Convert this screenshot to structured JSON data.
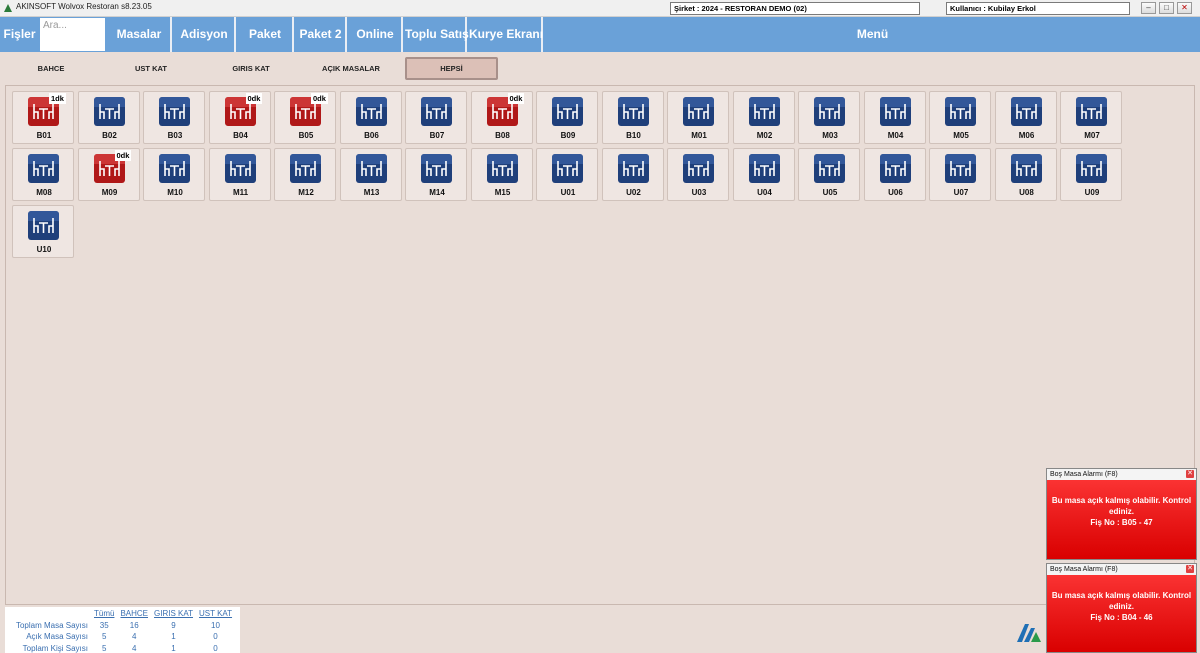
{
  "window": {
    "title": "AKINSOFT Wolvox Restoran s8.23.05",
    "company": "Şirket : 2024 - RESTORAN DEMO (02)",
    "user": "Kullanıcı : Kubilay Erkol"
  },
  "nav": {
    "fisler": "Fişler",
    "search_placeholder": "Ara...",
    "masalar": "Masalar",
    "adisyon": "Adisyon",
    "paket": "Paket",
    "paket2": "Paket 2",
    "online": "Online",
    "toplu_satis": "Toplu Satış",
    "kurye": "Kurye Ekranı",
    "menu": "Menü"
  },
  "floors": [
    "BAHCE",
    "UST KAT",
    "GIRIS KAT",
    "AÇIK MASALAR",
    "HEPSİ"
  ],
  "active_floor": "HEPSİ",
  "colors": {
    "accent": "#6aa1d8",
    "table_free": "#1f3f7a",
    "table_open": "#b01818",
    "alarm": "#e60000"
  },
  "tables": [
    {
      "name": "B01",
      "open": true,
      "badge": "1dk"
    },
    {
      "name": "B02",
      "open": false,
      "badge": ""
    },
    {
      "name": "B03",
      "open": false,
      "badge": ""
    },
    {
      "name": "B04",
      "open": true,
      "badge": "0dk"
    },
    {
      "name": "B05",
      "open": true,
      "badge": "0dk"
    },
    {
      "name": "B06",
      "open": false,
      "badge": ""
    },
    {
      "name": "B07",
      "open": false,
      "badge": ""
    },
    {
      "name": "B08",
      "open": true,
      "badge": "0dk"
    },
    {
      "name": "B09",
      "open": false,
      "badge": ""
    },
    {
      "name": "B10",
      "open": false,
      "badge": ""
    },
    {
      "name": "M01",
      "open": false,
      "badge": ""
    },
    {
      "name": "M02",
      "open": false,
      "badge": ""
    },
    {
      "name": "M03",
      "open": false,
      "badge": ""
    },
    {
      "name": "M04",
      "open": false,
      "badge": ""
    },
    {
      "name": "M05",
      "open": false,
      "badge": ""
    },
    {
      "name": "M06",
      "open": false,
      "badge": ""
    },
    {
      "name": "M07",
      "open": false,
      "badge": ""
    },
    {
      "name": "M08",
      "open": false,
      "badge": ""
    },
    {
      "name": "M09",
      "open": true,
      "badge": "0dk"
    },
    {
      "name": "M10",
      "open": false,
      "badge": ""
    },
    {
      "name": "M11",
      "open": false,
      "badge": ""
    },
    {
      "name": "M12",
      "open": false,
      "badge": ""
    },
    {
      "name": "M13",
      "open": false,
      "badge": ""
    },
    {
      "name": "M14",
      "open": false,
      "badge": ""
    },
    {
      "name": "M15",
      "open": false,
      "badge": ""
    },
    {
      "name": "U01",
      "open": false,
      "badge": ""
    },
    {
      "name": "U02",
      "open": false,
      "badge": ""
    },
    {
      "name": "U03",
      "open": false,
      "badge": ""
    },
    {
      "name": "U04",
      "open": false,
      "badge": ""
    },
    {
      "name": "U05",
      "open": false,
      "badge": ""
    },
    {
      "name": "U06",
      "open": false,
      "badge": ""
    },
    {
      "name": "U07",
      "open": false,
      "badge": ""
    },
    {
      "name": "U08",
      "open": false,
      "badge": ""
    },
    {
      "name": "U09",
      "open": false,
      "badge": ""
    },
    {
      "name": "U10",
      "open": false,
      "badge": ""
    }
  ],
  "stats": {
    "headers": [
      "Tümü",
      "BAHCE",
      "GIRIS KAT",
      "UST KAT"
    ],
    "rows": [
      {
        "label": "Toplam Masa Sayısı",
        "values": [
          "35",
          "16",
          "9",
          "10"
        ]
      },
      {
        "label": "Açık Masa Sayısı",
        "values": [
          "5",
          "4",
          "1",
          "0"
        ]
      },
      {
        "label": "Toplam Kişi Sayısı",
        "values": [
          "5",
          "4",
          "1",
          "0"
        ]
      }
    ]
  },
  "alarms": [
    {
      "title": "Boş Masa Alarmı (F8)",
      "message": "Bu masa açık kalmış olabilir. Kontrol ediniz.",
      "fis": "Fiş No : B05 - 47"
    },
    {
      "title": "Boş Masa Alarmı (F8)",
      "message": "Bu masa açık kalmış olabilir. Kontrol ediniz.",
      "fis": "Fiş No : B04 - 46"
    }
  ]
}
